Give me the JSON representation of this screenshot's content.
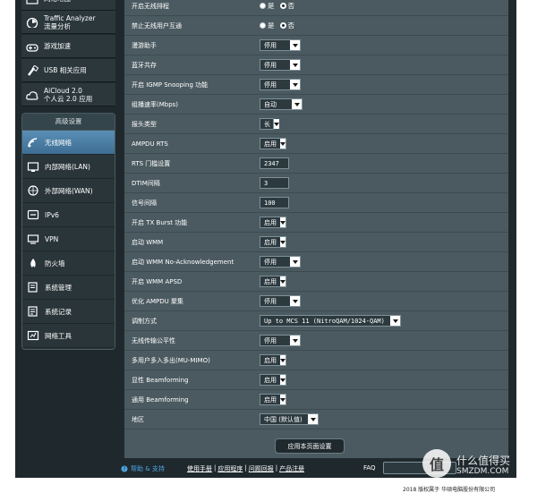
{
  "sidebar": {
    "top_items": [
      {
        "label": "网络地图",
        "icon": "network-map-icon"
      },
      {
        "label": "Traffic Analyzer",
        "sub": "流量分析",
        "icon": "traffic-analyzer-icon"
      },
      {
        "label": "游戏加速",
        "icon": "game-boost-icon"
      },
      {
        "label": "USB 相关应用",
        "icon": "usb-icon"
      },
      {
        "label": "AiCloud 2.0",
        "sub": "个人云 2.0 应用",
        "icon": "cloud-icon"
      }
    ],
    "advanced_title": "高级设置",
    "advanced_items": [
      {
        "label": "无线网络",
        "icon": "wireless-icon",
        "active": true
      },
      {
        "label": "内部网络(LAN)",
        "icon": "lan-icon"
      },
      {
        "label": "外部网络(WAN)",
        "icon": "wan-icon"
      },
      {
        "label": "IPv6",
        "icon": "ipv6-icon"
      },
      {
        "label": "VPN",
        "icon": "vpn-icon"
      },
      {
        "label": "防火墙",
        "icon": "firewall-icon"
      },
      {
        "label": "系统管理",
        "icon": "admin-icon"
      },
      {
        "label": "系统记录",
        "icon": "syslog-icon"
      },
      {
        "label": "网络工具",
        "icon": "network-tools-icon"
      }
    ]
  },
  "radio_labels": {
    "yes": "是",
    "no": "否"
  },
  "settings": [
    {
      "label": "开启无线排程",
      "type": "radio",
      "value": "否"
    },
    {
      "label": "禁止无线用户互通",
      "type": "radio",
      "value": "否"
    },
    {
      "label": "漫游助手",
      "type": "select",
      "value": "停用"
    },
    {
      "label": "蓝牙共存",
      "type": "select",
      "value": "停用"
    },
    {
      "label": "开启 IGMP Snooping 功能",
      "type": "select",
      "value": "停用"
    },
    {
      "label": "组播速率(Mbps)",
      "type": "select",
      "value": "自动"
    },
    {
      "label": "报头类型",
      "type": "select",
      "value": "长"
    },
    {
      "label": "AMPDU RTS",
      "type": "select",
      "value": "启用"
    },
    {
      "label": "RTS 门槛设置",
      "type": "text",
      "value": "2347"
    },
    {
      "label": "DTIM间隔",
      "type": "text",
      "value": "3"
    },
    {
      "label": "信号间隔",
      "type": "text",
      "value": "100"
    },
    {
      "label": "开启 TX Burst 功能",
      "type": "select",
      "value": "启用"
    },
    {
      "label": "启动 WMM",
      "type": "select",
      "value": "启用"
    },
    {
      "label": "启动 WMM No-Acknowledgement",
      "type": "select",
      "value": "停用"
    },
    {
      "label": "开启 WMM APSD",
      "type": "select",
      "value": "启用"
    },
    {
      "label": "优化 AMPDU 聚集",
      "type": "select",
      "value": "停用"
    },
    {
      "label": "调制方式",
      "type": "select",
      "value": "Up to MCS 11 (NitroQAM/1024-QAM)"
    },
    {
      "label": "无线传输公平性",
      "type": "select",
      "value": "停用"
    },
    {
      "label": "多用户多入多出(MU-MIMO)",
      "type": "select",
      "value": "启用"
    },
    {
      "label": "显性 Beamforming",
      "type": "select",
      "value": "启用"
    },
    {
      "label": "通用 Beamforming",
      "type": "select",
      "value": "启用"
    },
    {
      "label": "地区",
      "type": "select",
      "value": "中国 (默认值)"
    }
  ],
  "apply_label": "应用本页面设置",
  "footer": {
    "help": "帮助 & 支持",
    "links": [
      "使用手册",
      "应用程序",
      "问题回报",
      "产品注册"
    ],
    "separator": "|",
    "faq": "FAQ"
  },
  "copyright": "2018 版权属于 华硕电脑股份有限公司",
  "watermark": {
    "logo": "值",
    "line1": "什么值得买",
    "line2": "SMZDM.COM"
  },
  "colors": {
    "panel": "#4b5a61",
    "frame": "#1f292d",
    "active": "#4a7ea6",
    "link": "#4fa6e6"
  }
}
